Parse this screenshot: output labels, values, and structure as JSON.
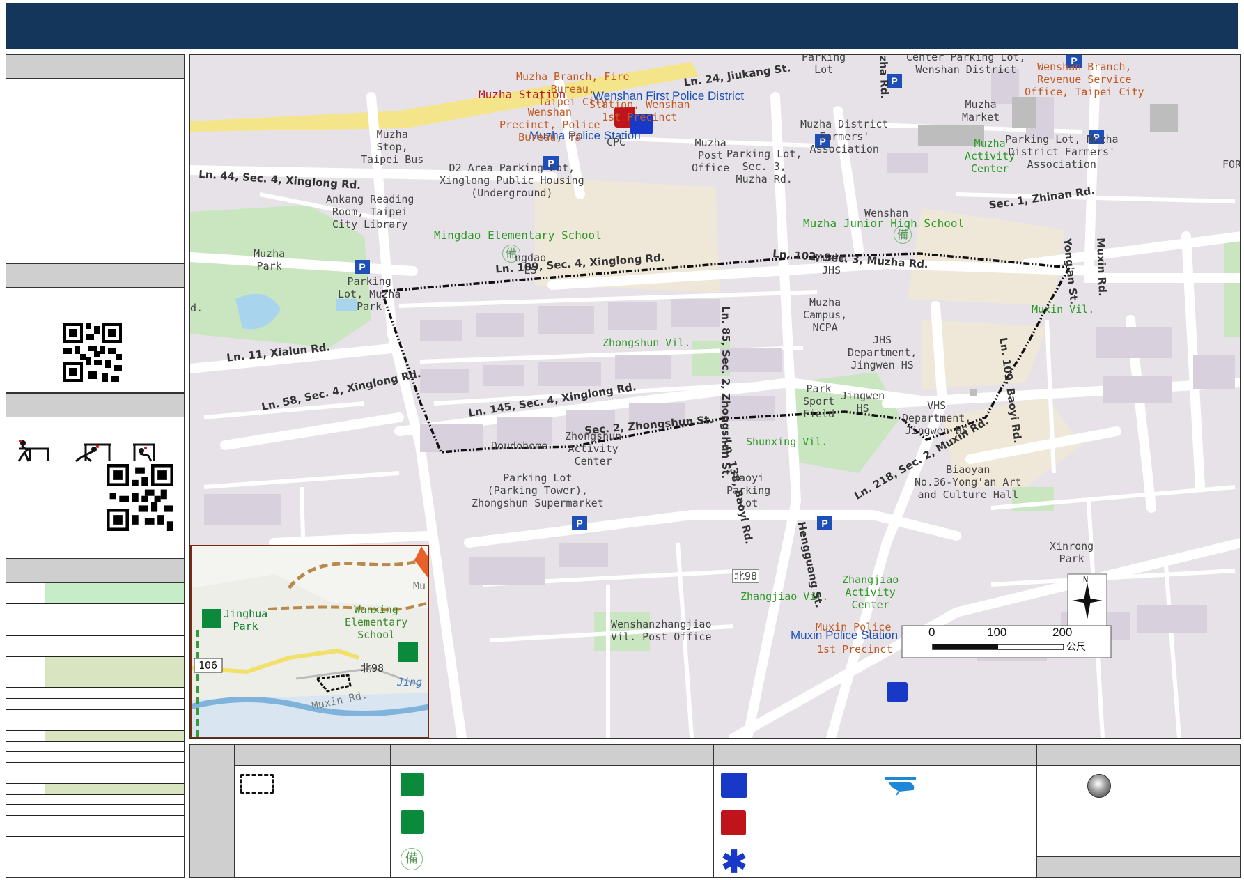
{
  "map": {
    "labels": {
      "muzha_fire": "Muzha Branch, Fire\nBureau,\nTaipei City",
      "muzha_station": "Muzha Station",
      "wenshan_first_police": "Wenshan First Police District",
      "muzha_police": "Muzha Police Station",
      "wenshan_precinct": "Wenshan\nPrecinct, Police\nBureau, Ta",
      "station_wenshan": "Station, Wenshan\n1st Precinct",
      "muzha_stop": "Muzha\nStop,\nTaipei Bus",
      "d2_parking": "D2 Area Parking Lot,\nXinglong Public Housing\n(Underground)",
      "cpc": "CPC",
      "muzha_post": "Muzha\nPost\nOffice",
      "parking_muzha_rd": "Parking Lot,\nSec. 3,\nMuzha Rd.",
      "farmers_assoc": "Muzha District\nFarmers'\nAssociation",
      "muzha_market": "Muzha\nMarket",
      "muzha_activity": "Muzha\nActivity\nCenter",
      "parking_farmers": "Parking Lot, Muzha\nDistrict Farmers'\nAssociation",
      "parking_lot_top": "Parking\nLot",
      "center_parking": "Center Parking Lot,\nWenshan District",
      "wenshan_branch": "Wenshan Branch,\nRevenue Service\nOffice, Taipei City",
      "fori": "FORI",
      "ankang": "Ankang Reading\nRoom, Taipei\nCity Library",
      "mingdao_es": "Mingdao Elementary School",
      "mingdao_short": "ngdao\nES",
      "wenshan_small": "Wenshan",
      "muzha_jhs": "Muzha Junior High School",
      "muzha_jhs_short": "Muzha\nJHS",
      "muzha_park": "Muzha\nPark",
      "parking_muzha_park": "Parking\nLot, Muzha\nPark",
      "muzha_campus": "Muzha\nCampus,\nNCPA",
      "zhongshun_vil": "Zhongshun Vil.",
      "muxin_vil": "Muxin Vil.",
      "jhs_dept": "JHS\nDepartment,\nJingwen HS",
      "jingwen_hs": "Jingwen\nHS",
      "park_sport": "Park\nSport\nField",
      "vhs_dept": "VHS\nDepartment,\nJingwen HS",
      "shunxing_vil": "Shunxing Vil.",
      "zhongshun_activity": "Zhongshun\nActivity\nCenter",
      "doudohome": "Doudohome",
      "parking_tower": "Parking Lot\n(Parking Tower),\nZhongshun Supermarket",
      "baoyi_parking": "Baoyi\nParking\nLot",
      "biaoyan": "Biaoyan\nNo.36-Yong'an Art\nand Culture Hall",
      "xinrong_park": "Xinrong\nPark",
      "zhangjiao_activity": "Zhangjiao\nActivity\nCenter",
      "zhangjiao_vil": "Zhangjiao Vil.",
      "muxin_police_red": "Muxin Police",
      "muxin_police": "Muxin Police Station",
      "first_precinct": "1st Precinct",
      "post_office": "Wenshanzhangjiao\nVil. Post Office",
      "bei98": "北98",
      "d_label": "d."
    },
    "roads": {
      "jiukang": "Ln. 24, Jiukang St.",
      "xinglong44": "Ln. 44, Sec. 4, Xinglong Rd.",
      "zhinan": "Sec. 1, Zhinan Rd.",
      "xinglong109": "Ln. 109, Sec. 4, Xinglong Rd.",
      "muzha102": "Ln. 102, Sec. 3, Muzha Rd.",
      "xialun": "Ln. 11, Xialun Rd.",
      "xinglong58": "Ln. 58, Sec. 4, Xinglong Rd.",
      "xinglong145": "Ln. 145, Sec. 4, Xinglong Rd.",
      "zhongshun_sec2": "Sec. 2, Zhongshun St.",
      "zhongshun85": "Ln. 85, Sec. 2, Zhongshun St.",
      "baoyi138": "Ln. 138, Baoyi Rd.",
      "hengguang": "Hengguang St.",
      "muxin218": "Ln. 218, Sec. 2, Muxin Rd.",
      "baoyi109": "Ln. 109, Baoyi Rd.",
      "yongan": "Yong'an St.",
      "muxin_rd": "Muxin Rd.",
      "zha_rd": "zha Rd."
    },
    "scale": {
      "t0": "0",
      "t100": "100",
      "t200": "200",
      "unit": "公尺"
    },
    "north": "N"
  },
  "inset": {
    "jinghua_park": "Jinghua\nPark",
    "wanxing_es": "Wanxing\nElementary\nSchool",
    "r106": "106",
    "bei98": "北98",
    "jing": "Jing",
    "muxin_rd": "Muxin Rd.",
    "mu": "Mu"
  },
  "colors": {
    "header": "#14365a",
    "panel_head": "#cfcfcf",
    "green_row": "#c6ecc8",
    "olive_row": "#d9e4c0"
  },
  "info_rows": [
    {
      "fill": "green"
    },
    {
      "fill": "none"
    },
    {
      "fill": "none"
    },
    {
      "fill": "none"
    },
    {
      "fill": "olive"
    },
    {
      "fill": "none"
    },
    {
      "fill": "none"
    },
    {
      "fill": "none"
    },
    {
      "fill": "olive"
    },
    {
      "fill": "none"
    },
    {
      "fill": "none"
    },
    {
      "fill": "none"
    },
    {
      "fill": "olive"
    },
    {
      "fill": "none"
    },
    {
      "fill": "none"
    },
    {
      "fill": "none"
    }
  ]
}
